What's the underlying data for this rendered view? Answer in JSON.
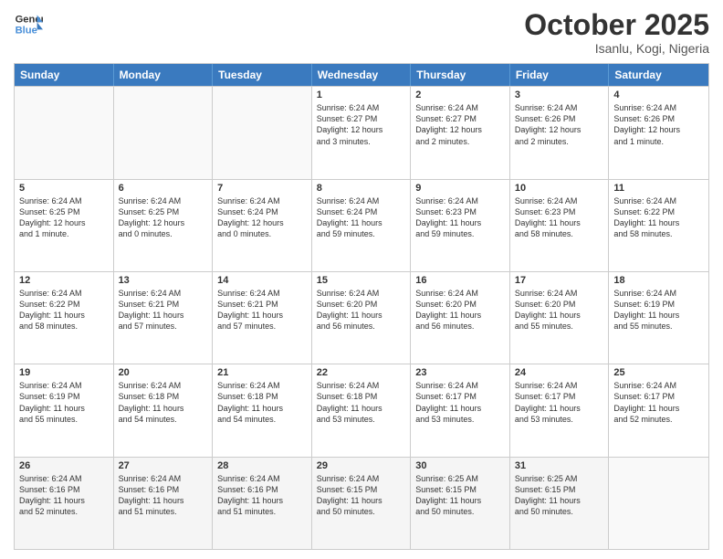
{
  "header": {
    "logo_line1": "General",
    "logo_line2": "Blue",
    "month": "October 2025",
    "location": "Isanlu, Kogi, Nigeria"
  },
  "days_of_week": [
    "Sunday",
    "Monday",
    "Tuesday",
    "Wednesday",
    "Thursday",
    "Friday",
    "Saturday"
  ],
  "weeks": [
    [
      {
        "day": "",
        "info": ""
      },
      {
        "day": "",
        "info": ""
      },
      {
        "day": "",
        "info": ""
      },
      {
        "day": "1",
        "info": "Sunrise: 6:24 AM\nSunset: 6:27 PM\nDaylight: 12 hours\nand 3 minutes."
      },
      {
        "day": "2",
        "info": "Sunrise: 6:24 AM\nSunset: 6:27 PM\nDaylight: 12 hours\nand 2 minutes."
      },
      {
        "day": "3",
        "info": "Sunrise: 6:24 AM\nSunset: 6:26 PM\nDaylight: 12 hours\nand 2 minutes."
      },
      {
        "day": "4",
        "info": "Sunrise: 6:24 AM\nSunset: 6:26 PM\nDaylight: 12 hours\nand 1 minute."
      }
    ],
    [
      {
        "day": "5",
        "info": "Sunrise: 6:24 AM\nSunset: 6:25 PM\nDaylight: 12 hours\nand 1 minute."
      },
      {
        "day": "6",
        "info": "Sunrise: 6:24 AM\nSunset: 6:25 PM\nDaylight: 12 hours\nand 0 minutes."
      },
      {
        "day": "7",
        "info": "Sunrise: 6:24 AM\nSunset: 6:24 PM\nDaylight: 12 hours\nand 0 minutes."
      },
      {
        "day": "8",
        "info": "Sunrise: 6:24 AM\nSunset: 6:24 PM\nDaylight: 11 hours\nand 59 minutes."
      },
      {
        "day": "9",
        "info": "Sunrise: 6:24 AM\nSunset: 6:23 PM\nDaylight: 11 hours\nand 59 minutes."
      },
      {
        "day": "10",
        "info": "Sunrise: 6:24 AM\nSunset: 6:23 PM\nDaylight: 11 hours\nand 58 minutes."
      },
      {
        "day": "11",
        "info": "Sunrise: 6:24 AM\nSunset: 6:22 PM\nDaylight: 11 hours\nand 58 minutes."
      }
    ],
    [
      {
        "day": "12",
        "info": "Sunrise: 6:24 AM\nSunset: 6:22 PM\nDaylight: 11 hours\nand 58 minutes."
      },
      {
        "day": "13",
        "info": "Sunrise: 6:24 AM\nSunset: 6:21 PM\nDaylight: 11 hours\nand 57 minutes."
      },
      {
        "day": "14",
        "info": "Sunrise: 6:24 AM\nSunset: 6:21 PM\nDaylight: 11 hours\nand 57 minutes."
      },
      {
        "day": "15",
        "info": "Sunrise: 6:24 AM\nSunset: 6:20 PM\nDaylight: 11 hours\nand 56 minutes."
      },
      {
        "day": "16",
        "info": "Sunrise: 6:24 AM\nSunset: 6:20 PM\nDaylight: 11 hours\nand 56 minutes."
      },
      {
        "day": "17",
        "info": "Sunrise: 6:24 AM\nSunset: 6:20 PM\nDaylight: 11 hours\nand 55 minutes."
      },
      {
        "day": "18",
        "info": "Sunrise: 6:24 AM\nSunset: 6:19 PM\nDaylight: 11 hours\nand 55 minutes."
      }
    ],
    [
      {
        "day": "19",
        "info": "Sunrise: 6:24 AM\nSunset: 6:19 PM\nDaylight: 11 hours\nand 55 minutes."
      },
      {
        "day": "20",
        "info": "Sunrise: 6:24 AM\nSunset: 6:18 PM\nDaylight: 11 hours\nand 54 minutes."
      },
      {
        "day": "21",
        "info": "Sunrise: 6:24 AM\nSunset: 6:18 PM\nDaylight: 11 hours\nand 54 minutes."
      },
      {
        "day": "22",
        "info": "Sunrise: 6:24 AM\nSunset: 6:18 PM\nDaylight: 11 hours\nand 53 minutes."
      },
      {
        "day": "23",
        "info": "Sunrise: 6:24 AM\nSunset: 6:17 PM\nDaylight: 11 hours\nand 53 minutes."
      },
      {
        "day": "24",
        "info": "Sunrise: 6:24 AM\nSunset: 6:17 PM\nDaylight: 11 hours\nand 53 minutes."
      },
      {
        "day": "25",
        "info": "Sunrise: 6:24 AM\nSunset: 6:17 PM\nDaylight: 11 hours\nand 52 minutes."
      }
    ],
    [
      {
        "day": "26",
        "info": "Sunrise: 6:24 AM\nSunset: 6:16 PM\nDaylight: 11 hours\nand 52 minutes."
      },
      {
        "day": "27",
        "info": "Sunrise: 6:24 AM\nSunset: 6:16 PM\nDaylight: 11 hours\nand 51 minutes."
      },
      {
        "day": "28",
        "info": "Sunrise: 6:24 AM\nSunset: 6:16 PM\nDaylight: 11 hours\nand 51 minutes."
      },
      {
        "day": "29",
        "info": "Sunrise: 6:24 AM\nSunset: 6:15 PM\nDaylight: 11 hours\nand 50 minutes."
      },
      {
        "day": "30",
        "info": "Sunrise: 6:25 AM\nSunset: 6:15 PM\nDaylight: 11 hours\nand 50 minutes."
      },
      {
        "day": "31",
        "info": "Sunrise: 6:25 AM\nSunset: 6:15 PM\nDaylight: 11 hours\nand 50 minutes."
      },
      {
        "day": "",
        "info": ""
      }
    ]
  ]
}
